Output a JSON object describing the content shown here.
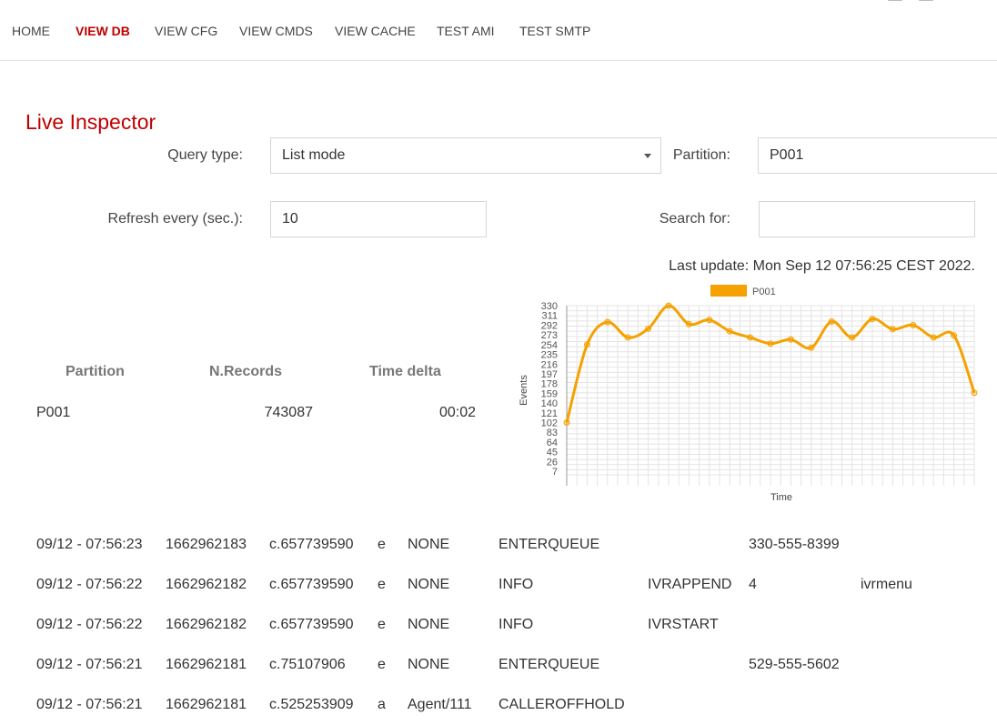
{
  "nav": {
    "items": [
      {
        "label": "HOME",
        "active": false
      },
      {
        "label": "VIEW DB",
        "active": true
      },
      {
        "label": "VIEW CFG",
        "active": false
      },
      {
        "label": "VIEW CMDS",
        "active": false
      },
      {
        "label": "VIEW CACHE",
        "active": false
      },
      {
        "label": "TEST AMI",
        "active": false
      },
      {
        "label": "TEST SMTP",
        "active": false
      }
    ]
  },
  "page": {
    "title": "Live Inspector"
  },
  "form": {
    "query_type_label": "Query type:",
    "query_type_value": "List mode",
    "partition_label": "Partition:",
    "partition_value": "P001",
    "refresh_label": "Refresh every (sec.):",
    "refresh_value": "10",
    "search_label": "Search for:",
    "search_value": ""
  },
  "last_update": "Last update: Mon Sep 12 07:56:25 CEST 2022.",
  "stats": {
    "headers": [
      "Partition",
      "N.Records",
      "Time delta"
    ],
    "rows": [
      [
        "P001",
        "743087",
        "00:02"
      ]
    ]
  },
  "colors": {
    "accent": "#c00000",
    "series": "#f5a100"
  },
  "chart_data": {
    "type": "line",
    "xlabel": "Time",
    "ylabel": "Events",
    "yticks": [
      330,
      311,
      292,
      273,
      254,
      235,
      216,
      197,
      178,
      159,
      140,
      121,
      102,
      83,
      64,
      45,
      26,
      7
    ],
    "ylim": [
      0,
      330
    ],
    "legend_position": "top",
    "grid": true,
    "series": [
      {
        "name": "P001",
        "values": [
          102,
          254,
          298,
          268,
          285,
          330,
          294,
          302,
          280,
          268,
          256,
          264,
          248,
          299,
          268,
          304,
          284,
          292,
          268,
          272,
          160
        ]
      }
    ]
  },
  "log": {
    "rows": [
      [
        "09/12 - 07:56:23",
        "1662962183",
        "c.657739590",
        "e",
        "NONE",
        "ENTERQUEUE",
        "",
        "330-555-8399",
        ""
      ],
      [
        "09/12 - 07:56:22",
        "1662962182",
        "c.657739590",
        "e",
        "NONE",
        "INFO",
        "IVRAPPEND",
        "4",
        "ivrmenu"
      ],
      [
        "09/12 - 07:56:22",
        "1662962182",
        "c.657739590",
        "e",
        "NONE",
        "INFO",
        "IVRSTART",
        "",
        ""
      ],
      [
        "09/12 - 07:56:21",
        "1662962181",
        "c.75107906",
        "e",
        "NONE",
        "ENTERQUEUE",
        "",
        "529-555-5602",
        ""
      ],
      [
        "09/12 - 07:56:21",
        "1662962181",
        "c.525253909",
        "a",
        "Agent/111",
        "CALLEROFFHOLD",
        "",
        "",
        ""
      ]
    ]
  }
}
